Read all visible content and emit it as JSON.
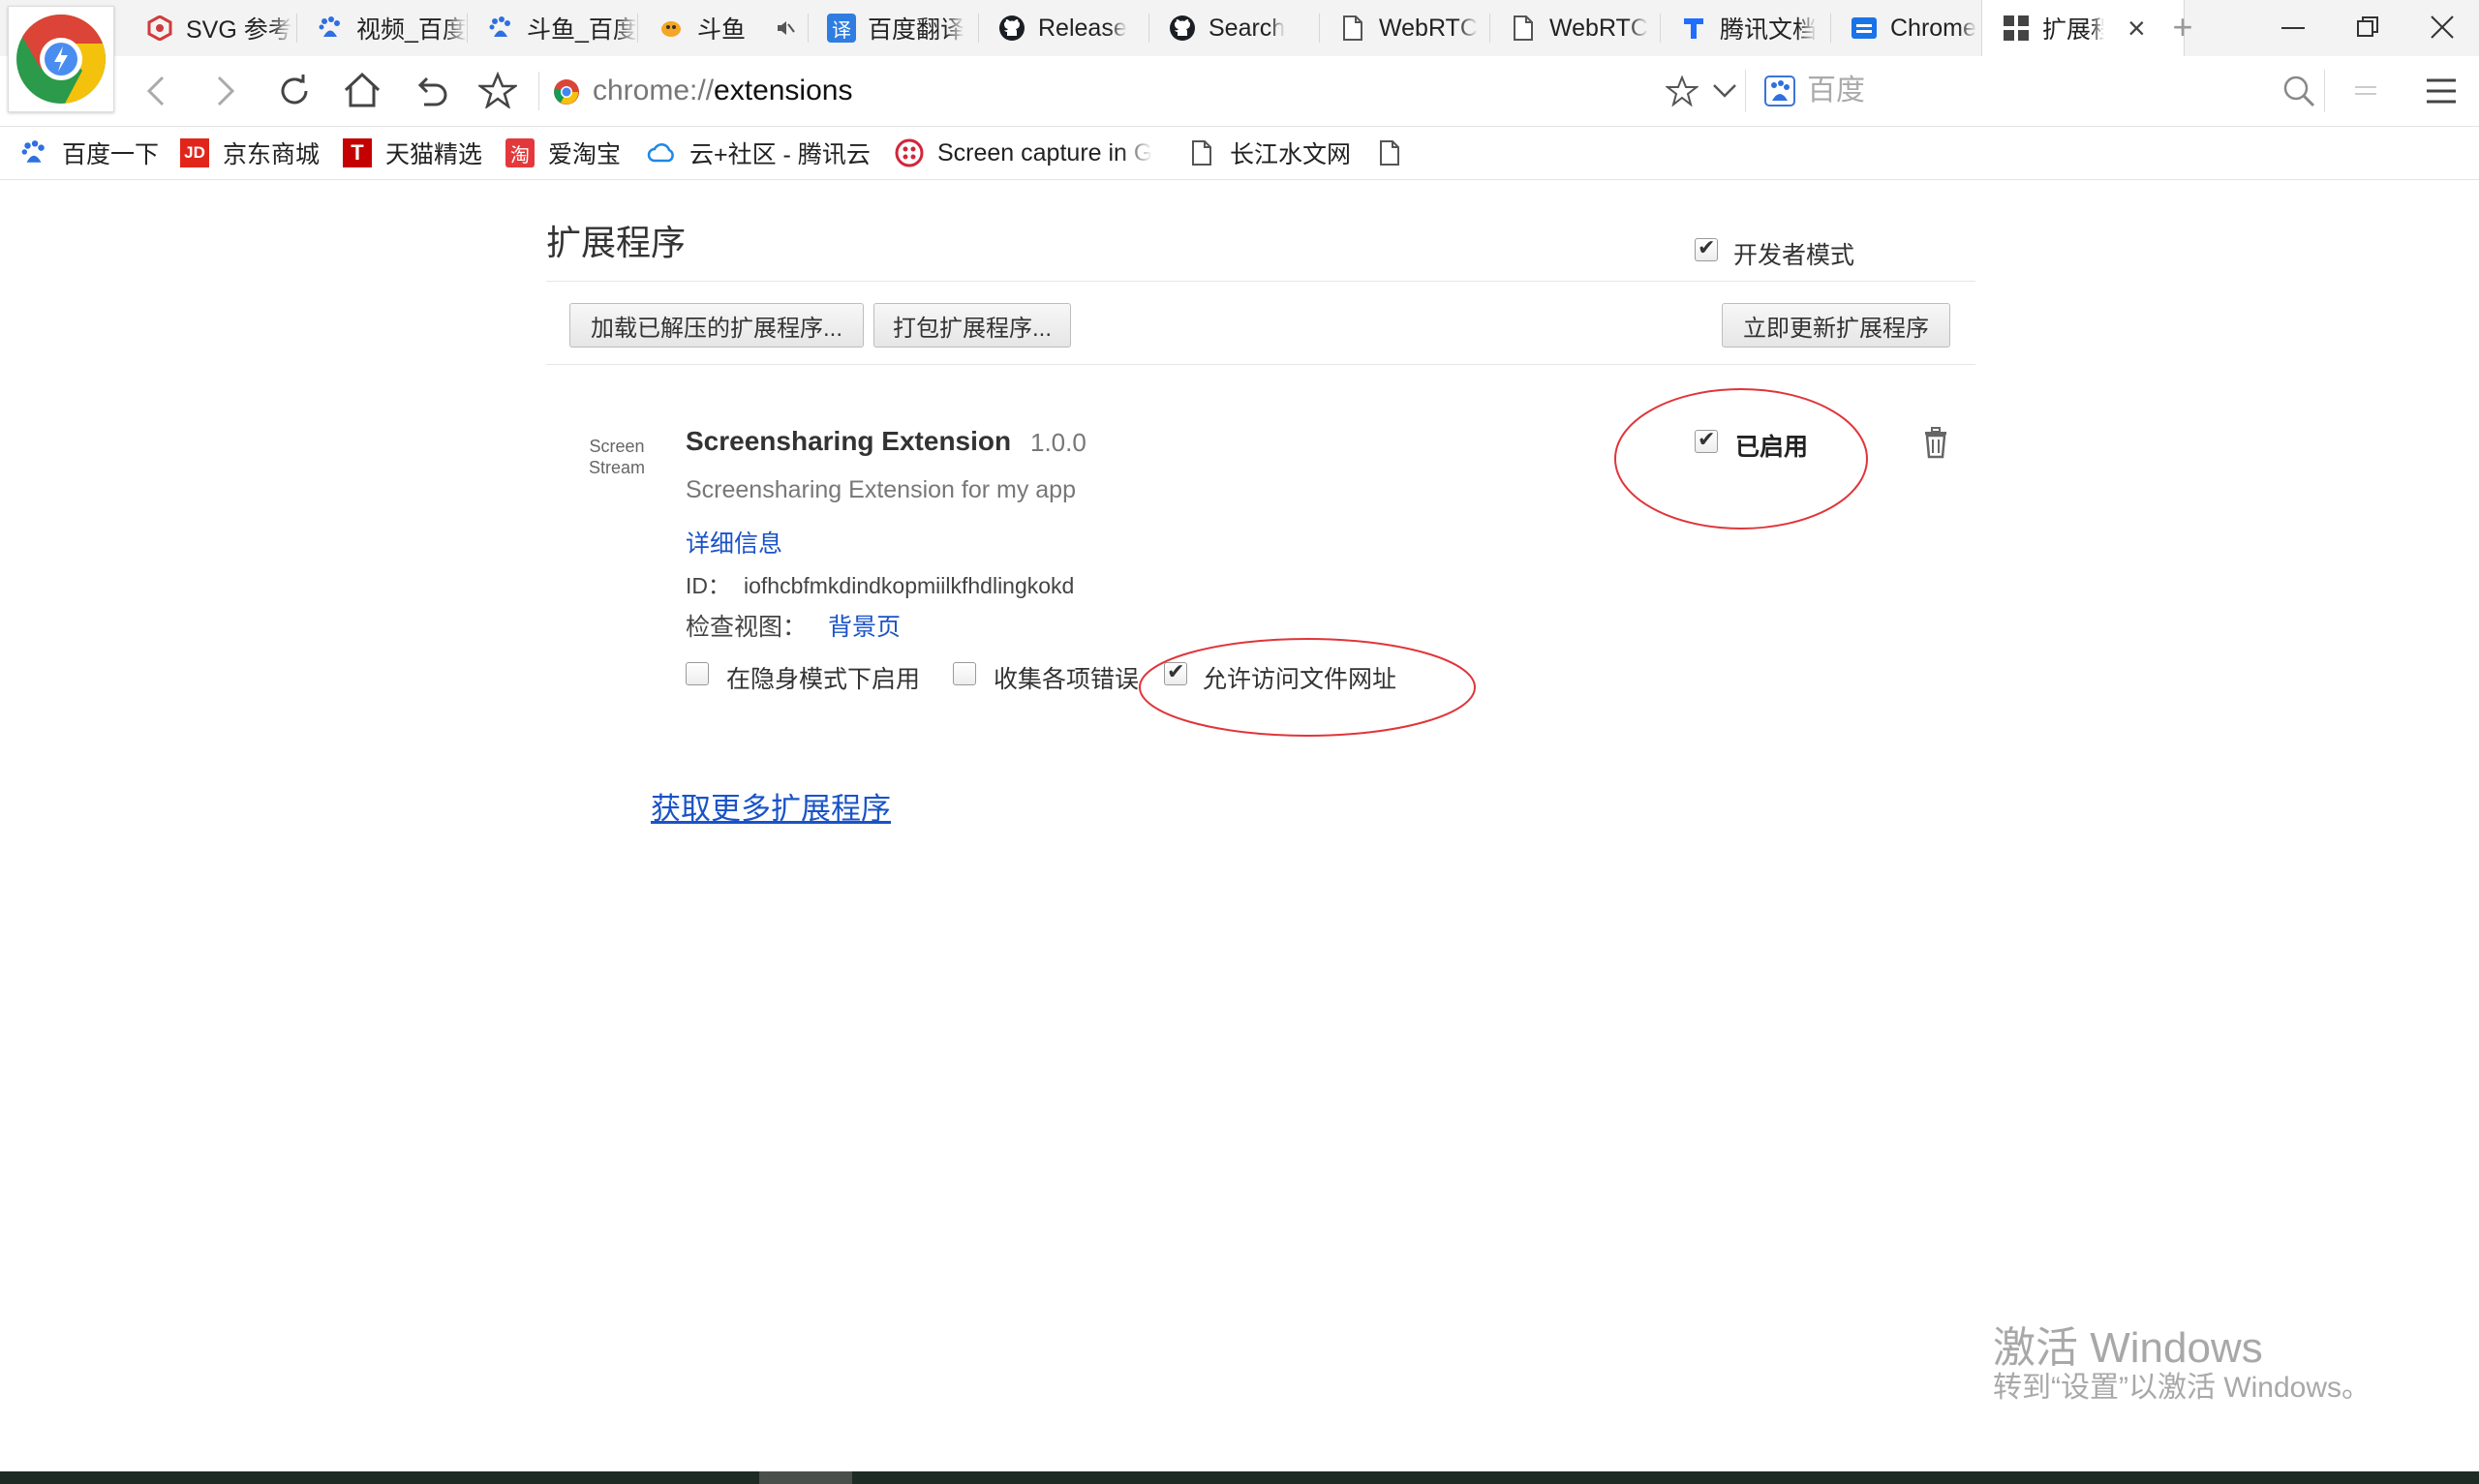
{
  "tabs": [
    {
      "label": "SVG 参考",
      "icon": "svg-reference-icon"
    },
    {
      "label": "视频_百度",
      "icon": "baidu-paw-icon"
    },
    {
      "label": "斗鱼_百度",
      "icon": "baidu-paw-icon"
    },
    {
      "label": "斗鱼",
      "icon": "douyu-icon",
      "muted_icon": "muted-speaker-icon"
    },
    {
      "label": "百度翻译",
      "icon": "baidu-translate-icon"
    },
    {
      "label": "Release",
      "icon": "github-icon"
    },
    {
      "label": "Search",
      "icon": "github-icon"
    },
    {
      "label": "WebRTC",
      "icon": "page-icon"
    },
    {
      "label": "WebRTC",
      "icon": "page-icon"
    },
    {
      "label": "腾讯文档",
      "icon": "tencent-docs-icon"
    },
    {
      "label": "Chrome",
      "icon": "chrome-docs-icon"
    },
    {
      "label": "扩展程序",
      "icon": "extensions-grid-icon",
      "active": true,
      "close": "×"
    }
  ],
  "address_bar": {
    "url_scheme": "chrome://",
    "url_path": "extensions",
    "search_engine": "百度"
  },
  "bookmarks": [
    {
      "label": "百度一下",
      "icon": "baidu-paw-icon"
    },
    {
      "label": "京东商城",
      "icon": "jd-icon",
      "badge": "JD"
    },
    {
      "label": "天猫精选",
      "icon": "tmall-icon",
      "badge": "T"
    },
    {
      "label": "爱淘宝",
      "icon": "taobao-icon",
      "badge": "淘"
    },
    {
      "label": "云+社区 - 腾讯云",
      "icon": "tencent-cloud-icon"
    },
    {
      "label": "Screen capture in G",
      "icon": "screen-capture-icon"
    },
    {
      "label": "长江水文网",
      "icon": "page-icon"
    },
    {
      "label": "",
      "icon": "page-icon"
    }
  ],
  "extensions_page": {
    "title": "扩展程序",
    "developer_mode_label": "开发者模式",
    "developer_mode_checked": true,
    "load_unpacked_label": "加载已解压的扩展程序...",
    "pack_label": "打包扩展程序...",
    "update_now_label": "立即更新扩展程序",
    "more_extensions_link": "获取更多扩展程序"
  },
  "extension": {
    "icon_text_1": "Screen",
    "icon_text_2": "Stream",
    "name": "Screensharing Extension",
    "version": "1.0.0",
    "description": "Screensharing Extension for my app",
    "details_link": "详细信息",
    "id_label": "ID：",
    "id_value": "iofhcbfmkdindkopmiilkfhdlingkokd",
    "inspect_label": "检查视图：",
    "inspect_link": "背景页",
    "enabled_label": "已启用",
    "enabled": true,
    "incognito_label": "在隐身模式下启用",
    "incognito": false,
    "collect_errors_label": "收集各项错误",
    "collect_errors": false,
    "file_access_label": "允许访问文件网址",
    "file_access": true
  },
  "watermark": {
    "line1": "激活 Windows",
    "line2": "转到“设置”以激活 Windows。"
  },
  "colors": {
    "link": "#1a53c7",
    "annotation": "#e0353a",
    "tab_strip": "#f3f3f3"
  }
}
